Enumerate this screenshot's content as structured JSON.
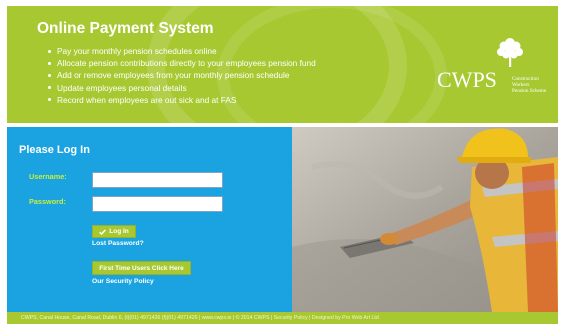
{
  "header": {
    "title": "Online Payment System",
    "bullets": [
      "Pay your monthly pension schedules online",
      "Allocate pension contributions directly to your employees pension fund",
      "Add or remove employees from your monthly pension schedule",
      "Update employees personal details",
      "Record when employees are out sick and at FAS"
    ],
    "logo": {
      "abbr": "CWPS",
      "line1": "Construction Workers",
      "line2": "Pension Scheme"
    }
  },
  "login": {
    "title": "Please Log In",
    "username_label": "Username:",
    "password_label": "Password:",
    "username_value": "",
    "password_value": "",
    "login_button": "Log In",
    "lost_password": "Lost Password?",
    "first_time_button": "First Time Users Click Here",
    "security_policy": "Our Security Policy"
  },
  "footer": {
    "text": "CWPS, Canal House, Canal Road, Dublin 6, (t)(01) 4971426 (f)(01) 4971426 | www.cwps.ie | © 2014 CWPS | Security Policy | Designed by Pro Web Art Ltd"
  },
  "colors": {
    "green": "#a8c832",
    "blue": "#1aa3e0",
    "label_green": "#c8ee3c"
  }
}
